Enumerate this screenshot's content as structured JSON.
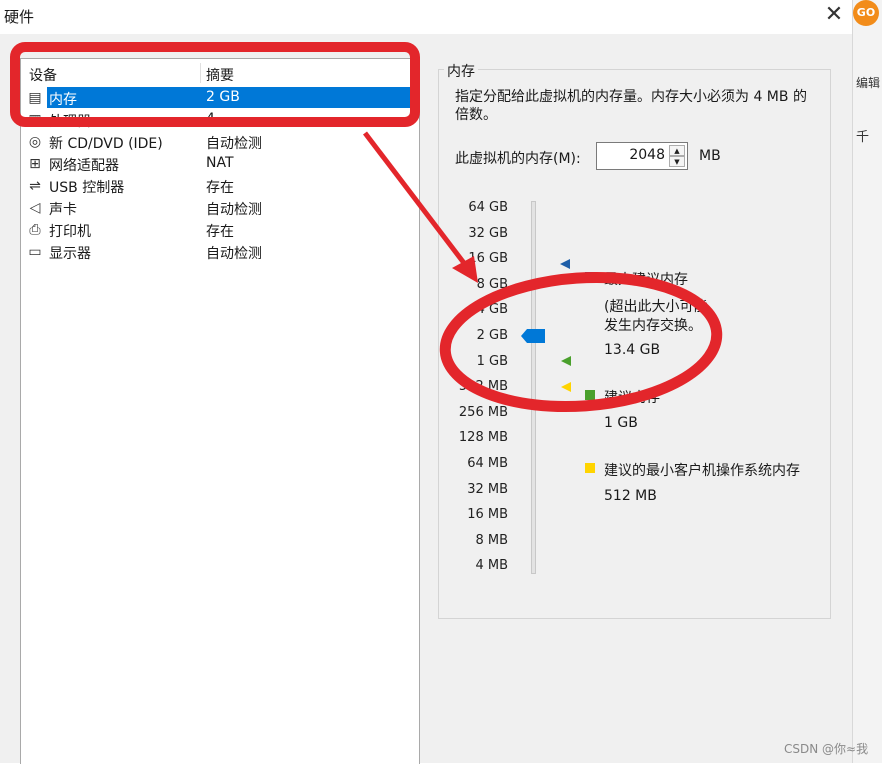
{
  "window": {
    "title": "硬件",
    "close_symbol": "✕"
  },
  "background_app": {
    "badge": "GO",
    "edit_label": "编辑",
    "side_char": "千"
  },
  "device_table": {
    "col_device": "设备",
    "col_summary": "摘要",
    "selected_index": 0,
    "rows": [
      {
        "name": "内存",
        "summary": "2 GB",
        "icon": "memory-icon",
        "glyph": "▤"
      },
      {
        "name": "处理器",
        "summary": "4",
        "icon": "processor-icon",
        "glyph": "▦"
      },
      {
        "name": "新 CD/DVD (IDE)",
        "summary": "自动检测",
        "icon": "cd-dvd-icon",
        "glyph": "◎"
      },
      {
        "name": "网络适配器",
        "summary": "NAT",
        "icon": "network-adapter-icon",
        "glyph": "⊞"
      },
      {
        "name": "USB 控制器",
        "summary": "存在",
        "icon": "usb-icon",
        "glyph": "⇌"
      },
      {
        "name": "声卡",
        "summary": "自动检测",
        "icon": "speaker-icon",
        "glyph": "◁"
      },
      {
        "name": "打印机",
        "summary": "存在",
        "icon": "printer-icon",
        "glyph": "⎙"
      },
      {
        "name": "显示器",
        "summary": "自动检测",
        "icon": "monitor-icon",
        "glyph": "▭"
      }
    ]
  },
  "memory": {
    "group_title": "内存",
    "description": "指定分配给此虚拟机的内存量。内存大小必须为 4 MB 的倍数。",
    "input_label": "此虚拟机的内存(M):",
    "input_value": "2048",
    "unit": "MB",
    "scale_ticks": [
      "64 GB",
      "32 GB",
      "16 GB",
      "8 GB",
      "4 GB",
      "2 GB",
      "1 GB",
      "512 MB",
      "256 MB",
      "128 MB",
      "64 MB",
      "32 MB",
      "16 MB",
      "8 MB",
      "4 MB"
    ],
    "slider_value": "2 GB",
    "legend": {
      "max": {
        "title": "最大建议内存",
        "note_line1": "(超出此大小可能",
        "note_line2": "发生内存交换。",
        "value": "13.4 GB",
        "color": "#1f5fa8"
      },
      "recommended": {
        "title": "建议内存",
        "value": "1 GB",
        "color": "#4aa02c"
      },
      "min_guest": {
        "title": "建议的最小客户机操作系统内存",
        "value": "512 MB",
        "color": "#ffd400"
      }
    },
    "slider_color": "#0078d7"
  },
  "annotation_color": "#e3262b",
  "watermark": "CSDN @你≈我"
}
